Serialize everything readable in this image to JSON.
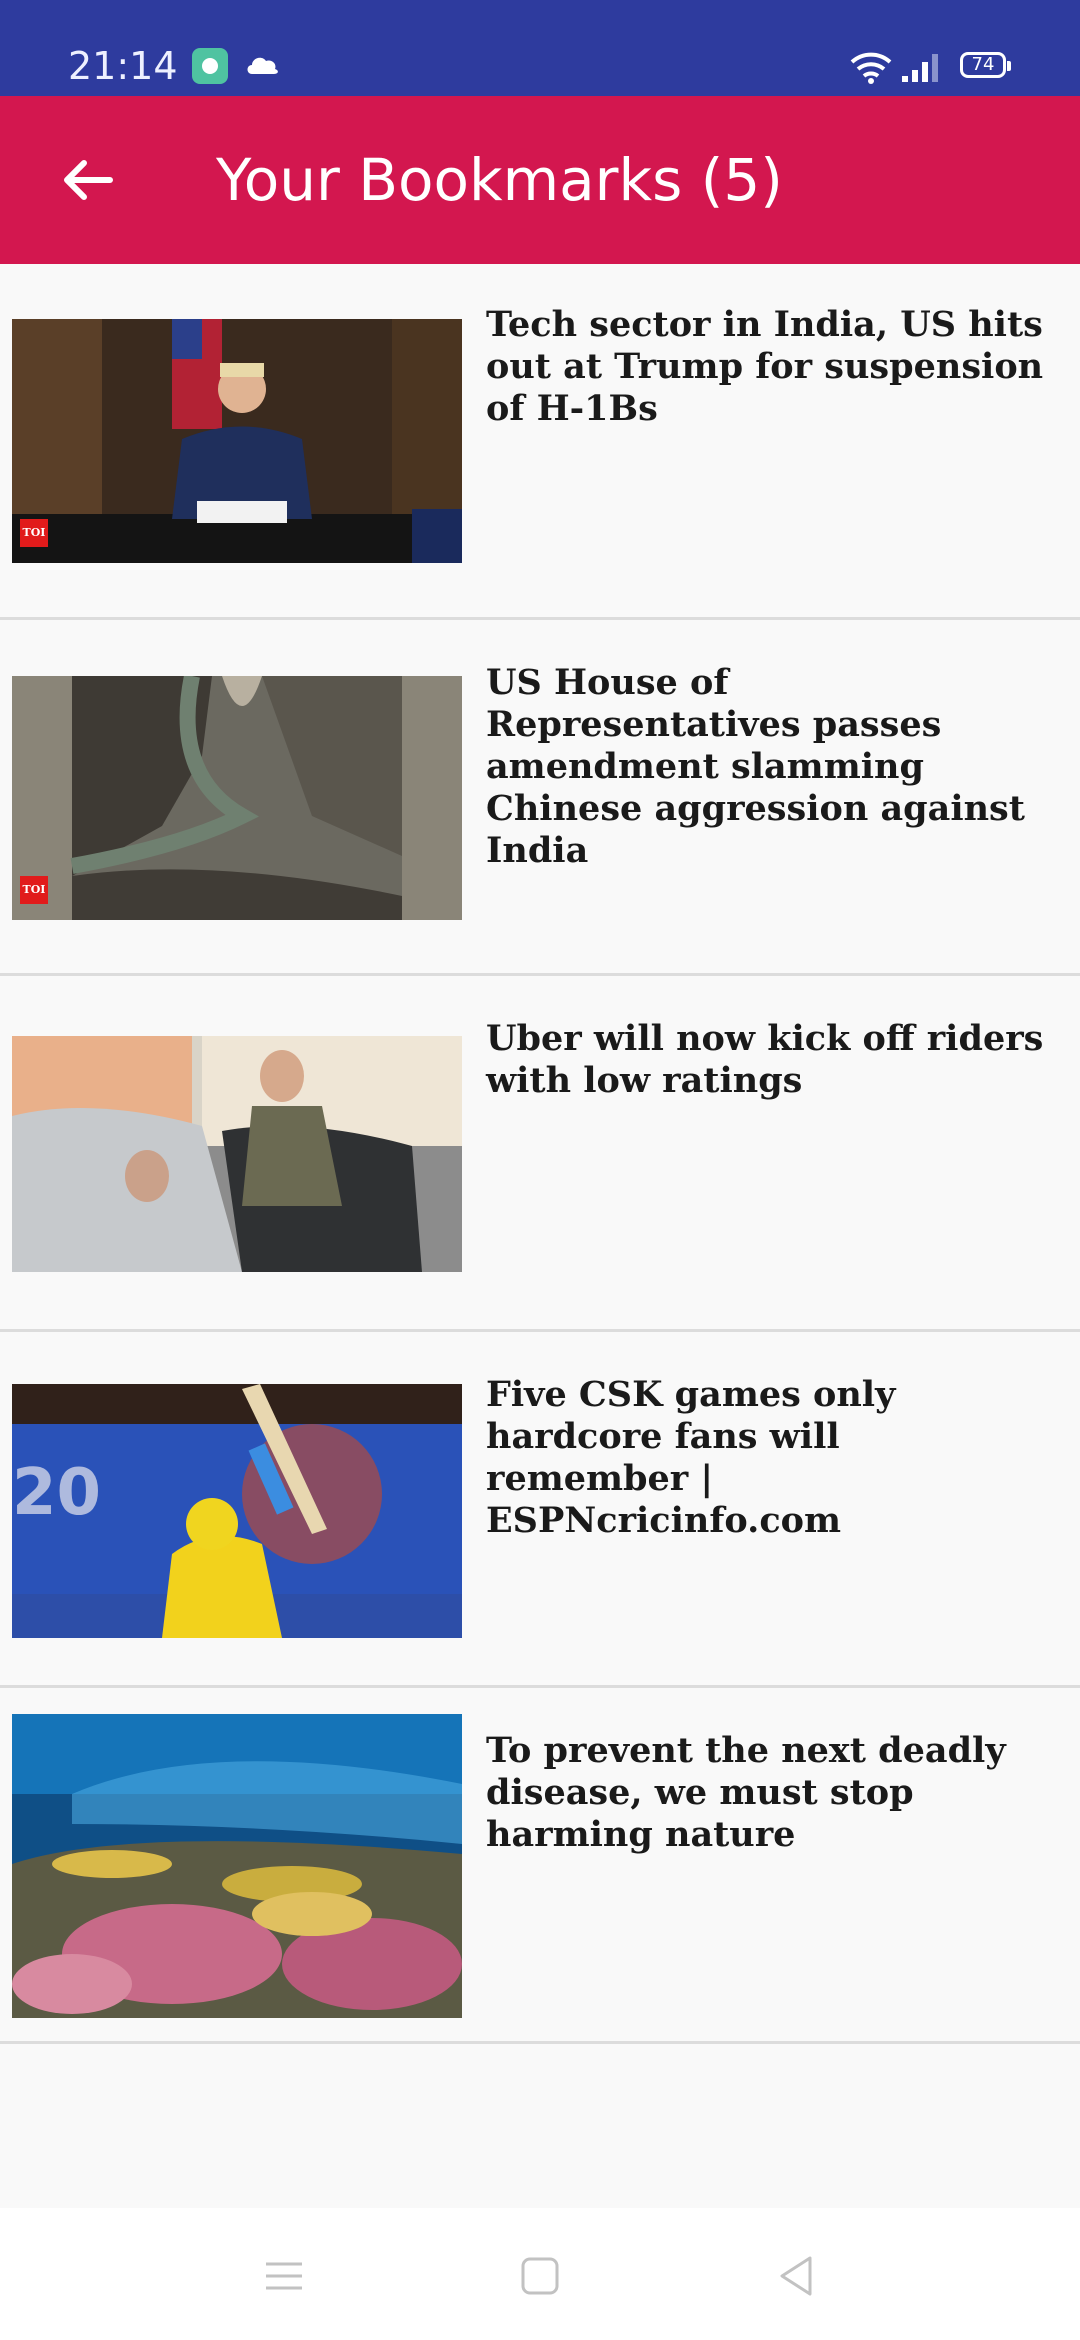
{
  "status_bar": {
    "time": "21:14",
    "battery": "74",
    "icons": [
      "app-notification-icon",
      "cloud-icon",
      "wifi-icon",
      "signal-icon",
      "battery-icon"
    ]
  },
  "app_bar": {
    "title": "Your Bookmarks (5)",
    "back_icon": "arrow-left-icon",
    "color": "#d3174f"
  },
  "bookmarks": [
    {
      "headline": "Tech sector in India, US hits out at Trump for suspension of H-1Bs",
      "image": "president-at-desk",
      "badge": "TOI"
    },
    {
      "headline": "US House of Representatives passes amendment slamming Chinese aggression against India",
      "image": "satellite-valley",
      "badge": "TOI"
    },
    {
      "headline": "Uber will now kick off riders with low ratings",
      "image": "rider-entering-car",
      "badge": ""
    },
    {
      "headline": "Five CSK games only hardcore fans will remember | ESPNcricinfo.com",
      "image": "cricketer-batting",
      "badge": ""
    },
    {
      "headline": "To prevent the next deadly disease, we must stop harming nature",
      "image": "coral-reef",
      "badge": ""
    }
  ],
  "nav": {
    "icons": [
      "menu-icon",
      "home-icon",
      "back-icon"
    ]
  }
}
